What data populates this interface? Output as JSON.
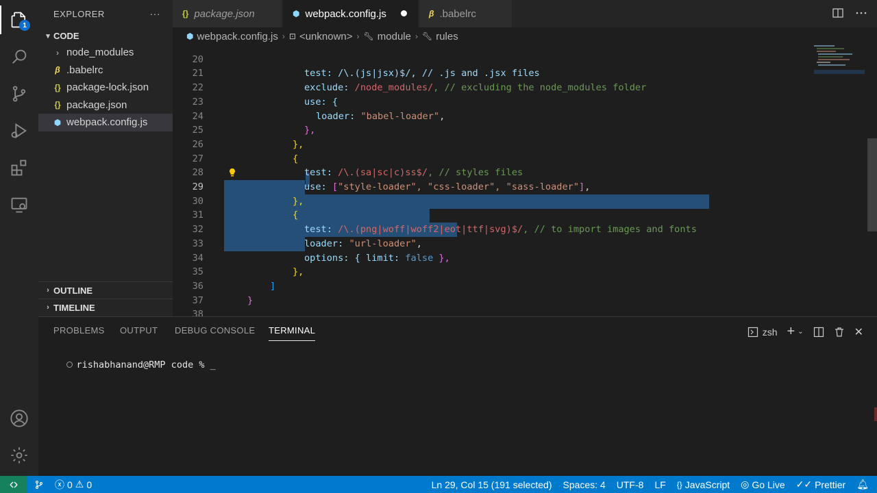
{
  "activity_bar": {
    "badge": "1",
    "items": [
      "explorer-icon",
      "search-icon",
      "source-control-icon",
      "run-debug-icon",
      "extensions-icon",
      "remote-explorer-icon",
      "account-icon",
      "settings-gear-icon"
    ]
  },
  "sidebar": {
    "title": "EXPLORER",
    "more": "···",
    "folder": "CODE",
    "items": [
      {
        "label": "node_modules",
        "icon": "chevron-right-icon"
      },
      {
        "label": ".babelrc",
        "icon": "babel-icon"
      },
      {
        "label": "package-lock.json",
        "icon": "json-icon"
      },
      {
        "label": "package.json",
        "icon": "json-icon"
      },
      {
        "label": "webpack.config.js",
        "icon": "webpack-icon"
      }
    ],
    "outline": "OUTLINE",
    "timeline": "TIMELINE"
  },
  "tabs": [
    {
      "label": "package.json",
      "icon": "{}"
    },
    {
      "label": "webpack.config.js",
      "icon": "⬢"
    },
    {
      "label": ".babelrc",
      "icon": "β"
    }
  ],
  "breadcrumb": [
    "webpack.config.js",
    "<unknown>",
    "module",
    "rules"
  ],
  "editor": {
    "line_numbers": [
      "20",
      "21",
      "22",
      "23",
      "24",
      "25",
      "26",
      "27",
      "28",
      "29",
      "30",
      "31",
      "32",
      "33",
      "34",
      "35",
      "36",
      "37",
      "38"
    ],
    "lines": {
      "l20": "test: /\\.(js|jsx)$/, // .js and .jsx files",
      "l21_key": "exclude: ",
      "l21_val": "/node_modules/",
      "l21_com": ", // excluding the node_modules folder",
      "l22": "use: {",
      "l23_key": "loader: ",
      "l23_val": "\"babel-loader\"",
      "l24": "},",
      "l25": "},",
      "l26": "{",
      "l27_key": "test: ",
      "l27_val": "/\\.(sa|sc|c)ss$/",
      "l27_com": ", // styles files",
      "l28_key": "use: ",
      "l28_vals": "\"style-loader\", \"css-loader\", \"sass-loader\"",
      "l29": "},",
      "l30": "{",
      "l31_key": "test: ",
      "l31_val": "/\\.(png|woff|woff2|eot|ttf|svg)$/",
      "l31_com": ", // to import images and fonts",
      "l32_key": "loader: ",
      "l32_val": "\"url-loader\"",
      "l33_key": "options",
      "l33_rest": ": { limit: ",
      "l33_lit": "false",
      "l34": "},",
      "l35": "]",
      "l36": "}",
      "l38": "}"
    }
  },
  "panel": {
    "tabs": [
      "PROBLEMS",
      "OUTPUT",
      "DEBUG CONSOLE",
      "TERMINAL"
    ],
    "shell": "zsh",
    "prompt": "rishabhanand@RMP code % _"
  },
  "status": {
    "errors": "0",
    "warnings": "0",
    "position": "Ln 29, Col 15 (191 selected)",
    "spaces": "Spaces: 4",
    "encoding": "UTF-8",
    "eol": "LF",
    "language": "JavaScript",
    "golive": "Go Live",
    "prettier": "Prettier"
  },
  "colors": {
    "accent": "#007acc",
    "selection": "#264f78",
    "remote": "#16825d"
  }
}
